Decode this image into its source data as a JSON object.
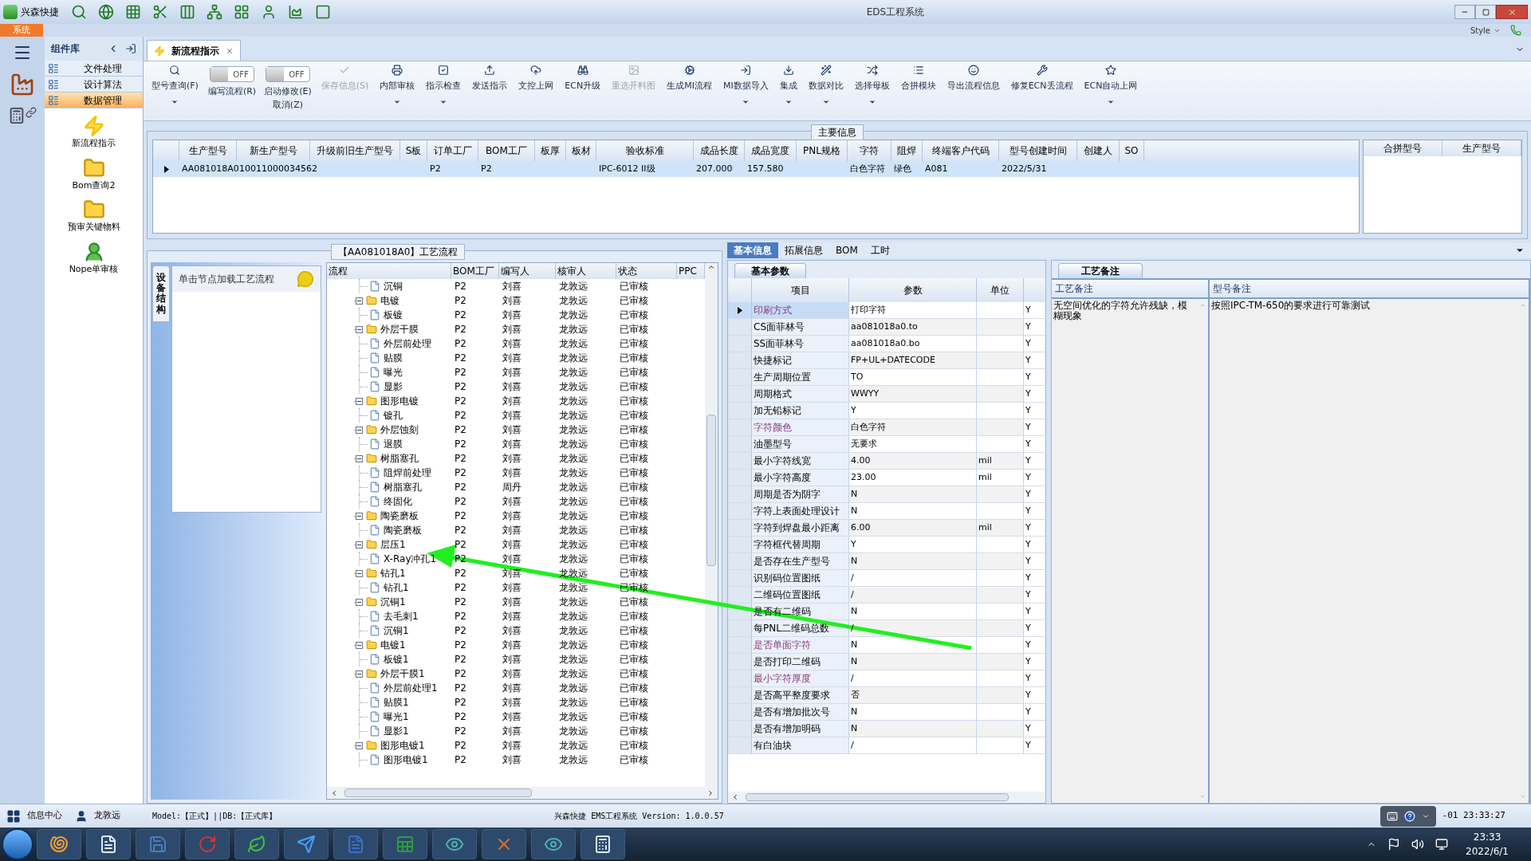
{
  "title_bar": {
    "app": "兴森快捷",
    "title": "EDS工程系统"
  },
  "ribbon": {
    "tab": "系统",
    "style": "Style"
  },
  "sidebar": {
    "title": "组件库",
    "sections": [
      {
        "label": "文件处理",
        "selected": false
      },
      {
        "label": "设计算法",
        "selected": false
      },
      {
        "label": "数据管理",
        "selected": true
      }
    ],
    "items": [
      {
        "label": "新流程指示",
        "kind": "bolt"
      },
      {
        "label": "Bom查询2",
        "kind": "folder"
      },
      {
        "label": "预审关键物料",
        "kind": "folder"
      },
      {
        "label": "Nope单审核",
        "kind": "person"
      }
    ]
  },
  "document_tabs": [
    {
      "label": "新流程指示",
      "selected": true
    }
  ],
  "toolbar": [
    {
      "kind": "button",
      "label": "型号查询(F)",
      "disabled": false,
      "has_menu": true
    },
    {
      "kind": "toggle",
      "label": "编写流程(R)",
      "switch": "OFF",
      "on": false
    },
    {
      "kind": "toggle",
      "label": "启动修改(E)",
      "switch": "OFF",
      "on": false,
      "sub_label": "取消(Z)"
    },
    {
      "kind": "button",
      "label": "保存信息(S)",
      "disabled": true,
      "has_menu": false
    },
    {
      "kind": "button",
      "label": "内部审核",
      "disabled": false,
      "has_menu": true
    },
    {
      "kind": "button",
      "label": "指示检查",
      "disabled": false,
      "has_menu": true
    },
    {
      "kind": "button",
      "label": "发送指示",
      "disabled": false,
      "has_menu": false
    },
    {
      "kind": "button",
      "label": "文控上网",
      "disabled": false,
      "has_menu": false
    },
    {
      "kind": "button",
      "label": "ECN升级",
      "disabled": false,
      "has_menu": false
    },
    {
      "kind": "button",
      "label": "重选开料图",
      "disabled": true,
      "has_menu": false
    },
    {
      "kind": "button",
      "label": "生成MI流程",
      "disabled": false,
      "has_menu": false
    },
    {
      "kind": "button",
      "label": "MI数据导入",
      "disabled": false,
      "has_menu": true
    },
    {
      "kind": "button",
      "label": "集成",
      "disabled": false,
      "has_menu": true
    },
    {
      "kind": "button",
      "label": "数据对比",
      "disabled": false,
      "has_menu": true
    },
    {
      "kind": "button",
      "label": "选择母板",
      "disabled": false,
      "has_menu": true
    },
    {
      "kind": "button",
      "label": "合拼模块",
      "disabled": false,
      "has_menu": false
    },
    {
      "kind": "button",
      "label": "导出流程信息",
      "disabled": false,
      "has_menu": false
    },
    {
      "kind": "button",
      "label": "修复ECN丢流程",
      "disabled": false,
      "has_menu": false
    },
    {
      "kind": "button",
      "label": "ECN自动上网",
      "disabled": false,
      "has_menu": true
    }
  ],
  "main_info": {
    "title": "主要信息",
    "row_selected": true,
    "columns": [
      {
        "header": "生产型号",
        "value": "AA081018A0"
      },
      {
        "header": "新生产型号",
        "value": "10011000034562"
      },
      {
        "header": "升级前旧生产型号"
      },
      {
        "header": "S板"
      },
      {
        "header": "订单工厂",
        "value": "P2"
      },
      {
        "header": "BOM工厂",
        "value": "P2"
      },
      {
        "header": "板厚"
      },
      {
        "header": "板材"
      },
      {
        "header": "验收标准",
        "value": "IPC-6012 II级"
      },
      {
        "header": "成品长度",
        "value": "207.000"
      },
      {
        "header": "成品宽度",
        "value": "157.580"
      },
      {
        "header": "PNL规格"
      },
      {
        "header": "字符",
        "value": "白色字符"
      },
      {
        "header": "阻焊",
        "value": "绿色"
      },
      {
        "header": "终端客户代码",
        "value": "A081"
      },
      {
        "header": "型号创建时间",
        "value": "2022/5/31"
      },
      {
        "header": "创建人"
      },
      {
        "header": "SO"
      }
    ]
  },
  "merge_table": {
    "columns": [
      "合拼型号",
      "生产型号"
    ]
  },
  "process_flow": {
    "title": "【AA081018A0】工艺流程",
    "side_tab": "设备结构",
    "hint": "单击节点加载工艺流程",
    "columns": [
      "流程",
      "BOM工厂",
      "编写人",
      "核审人",
      "状态",
      "PPC"
    ],
    "nodes": [
      {
        "name": "沉铜",
        "kind": "leaf",
        "bom": "P2",
        "writer": "刘喜",
        "reviewer": "龙敦远",
        "status": "已审核"
      },
      {
        "name": "电镀",
        "kind": "folder",
        "expanded": true,
        "bom": "P2",
        "writer": "刘喜",
        "reviewer": "龙敦远",
        "status": "已审核",
        "children": [
          {
            "name": "板镀",
            "kind": "leaf",
            "bom": "P2",
            "writer": "刘喜",
            "reviewer": "龙敦远",
            "status": "已审核"
          }
        ]
      },
      {
        "name": "外层干膜",
        "kind": "folder",
        "expanded": true,
        "bom": "P2",
        "writer": "刘喜",
        "reviewer": "龙敦远",
        "status": "已审核",
        "children": [
          {
            "name": "外层前处理",
            "kind": "leaf",
            "bom": "P2",
            "writer": "刘喜",
            "reviewer": "龙敦远",
            "status": "已审核"
          },
          {
            "name": "贴膜",
            "kind": "leaf",
            "bom": "P2",
            "writer": "刘喜",
            "reviewer": "龙敦远",
            "status": "已审核"
          },
          {
            "name": "曝光",
            "kind": "leaf",
            "bom": "P2",
            "writer": "刘喜",
            "reviewer": "龙敦远",
            "status": "已审核"
          },
          {
            "name": "显影",
            "kind": "leaf",
            "bom": "P2",
            "writer": "刘喜",
            "reviewer": "龙敦远",
            "status": "已审核"
          }
        ]
      },
      {
        "name": "图形电镀",
        "kind": "folder",
        "expanded": true,
        "bom": "P2",
        "writer": "刘喜",
        "reviewer": "龙敦远",
        "status": "已审核",
        "children": [
          {
            "name": "镀孔",
            "kind": "leaf",
            "bom": "P2",
            "writer": "刘喜",
            "reviewer": "龙敦远",
            "status": "已审核"
          }
        ]
      },
      {
        "name": "外层蚀刻",
        "kind": "folder",
        "expanded": true,
        "bom": "P2",
        "writer": "刘喜",
        "reviewer": "龙敦远",
        "status": "已审核",
        "children": [
          {
            "name": "退膜",
            "kind": "leaf",
            "bom": "P2",
            "writer": "刘喜",
            "reviewer": "龙敦远",
            "status": "已审核"
          }
        ]
      },
      {
        "name": "树脂塞孔",
        "kind": "folder",
        "expanded": true,
        "bom": "P2",
        "writer": "刘喜",
        "reviewer": "龙敦远",
        "status": "已审核",
        "children": [
          {
            "name": "阻焊前处理",
            "kind": "leaf",
            "bom": "P2",
            "writer": "刘喜",
            "reviewer": "龙敦远",
            "status": "已审核"
          },
          {
            "name": "树脂塞孔",
            "kind": "leaf",
            "bom": "P2",
            "writer": "周丹",
            "reviewer": "龙敦远",
            "status": "已审核"
          },
          {
            "name": "终固化",
            "kind": "leaf",
            "bom": "P2",
            "writer": "刘喜",
            "reviewer": "龙敦远",
            "status": "已审核"
          }
        ]
      },
      {
        "name": "陶瓷磨板",
        "kind": "folder",
        "expanded": true,
        "bom": "P2",
        "writer": "刘喜",
        "reviewer": "龙敦远",
        "status": "已审核",
        "children": [
          {
            "name": "陶瓷磨板",
            "kind": "leaf",
            "bom": "P2",
            "writer": "刘喜",
            "reviewer": "龙敦远",
            "status": "已审核"
          }
        ]
      },
      {
        "name": "层压1",
        "kind": "folder",
        "expanded": true,
        "bom": "P2",
        "writer": "刘喜",
        "reviewer": "龙敦远",
        "status": "已审核",
        "children": [
          {
            "name": "X-Ray冲孔1",
            "kind": "leaf",
            "bom": "P2",
            "writer": "刘喜",
            "reviewer": "龙敦远",
            "status": "已审核"
          }
        ]
      },
      {
        "name": "钻孔1",
        "kind": "folder",
        "expanded": true,
        "bom": "P2",
        "writer": "刘喜",
        "reviewer": "龙敦远",
        "status": "已审核",
        "children": [
          {
            "name": "钻孔1",
            "kind": "leaf",
            "bom": "P2",
            "writer": "刘喜",
            "reviewer": "龙敦远",
            "status": "已审核"
          }
        ]
      },
      {
        "name": "沉铜1",
        "kind": "folder",
        "expanded": true,
        "bom": "P2",
        "writer": "刘喜",
        "reviewer": "龙敦远",
        "status": "已审核",
        "children": [
          {
            "name": "去毛刺1",
            "kind": "leaf",
            "bom": "P2",
            "writer": "刘喜",
            "reviewer": "龙敦远",
            "status": "已审核"
          },
          {
            "name": "沉铜1",
            "kind": "leaf",
            "bom": "P2",
            "writer": "刘喜",
            "reviewer": "龙敦远",
            "status": "已审核"
          }
        ]
      },
      {
        "name": "电镀1",
        "kind": "folder",
        "expanded": true,
        "bom": "P2",
        "writer": "刘喜",
        "reviewer": "龙敦远",
        "status": "已审核",
        "children": [
          {
            "name": "板镀1",
            "kind": "leaf",
            "bom": "P2",
            "writer": "刘喜",
            "reviewer": "龙敦远",
            "status": "已审核"
          }
        ]
      },
      {
        "name": "外层干膜1",
        "kind": "folder",
        "expanded": true,
        "bom": "P2",
        "writer": "刘喜",
        "reviewer": "龙敦远",
        "status": "已审核",
        "children": [
          {
            "name": "外层前处理1",
            "kind": "leaf",
            "bom": "P2",
            "writer": "刘喜",
            "reviewer": "龙敦远",
            "status": "已审核"
          },
          {
            "name": "贴膜1",
            "kind": "leaf",
            "bom": "P2",
            "writer": "刘喜",
            "reviewer": "龙敦远",
            "status": "已审核"
          },
          {
            "name": "曝光1",
            "kind": "leaf",
            "bom": "P2",
            "writer": "刘喜",
            "reviewer": "龙敦远",
            "status": "已审核"
          },
          {
            "name": "显影1",
            "kind": "leaf",
            "bom": "P2",
            "writer": "刘喜",
            "reviewer": "龙敦远",
            "status": "已审核"
          }
        ]
      },
      {
        "name": "图形电镀1",
        "kind": "folder",
        "expanded": true,
        "bom": "P2",
        "writer": "刘喜",
        "reviewer": "龙敦远",
        "status": "已审核",
        "children": [
          {
            "name": "图形电镀1",
            "kind": "leaf",
            "bom": "P2",
            "writer": "刘喜",
            "reviewer": "龙敦远",
            "status": "已审核"
          }
        ]
      }
    ]
  },
  "detail_tabs": [
    {
      "label": "基本信息",
      "selected": true
    },
    {
      "label": "拓展信息",
      "selected": false
    },
    {
      "label": "BOM",
      "selected": false
    },
    {
      "label": "工时",
      "selected": false
    }
  ],
  "basic_params": {
    "tab": "基本参数",
    "columns": [
      "项目",
      "参数",
      "单位"
    ],
    "rows": [
      {
        "item": "印刷方式",
        "value": "打印字符",
        "column_4": "Y",
        "highlighted": true,
        "selected": true
      },
      {
        "item": "CS面菲林号",
        "value": "aa081018a0.to",
        "column_4": "Y",
        "highlighted": false,
        "selected": false
      },
      {
        "item": "SS面菲林号",
        "value": "aa081018a0.bo",
        "column_4": "Y",
        "highlighted": false,
        "selected": false
      },
      {
        "item": "快捷标记",
        "value": "FP+UL+DATECODE",
        "column_4": "Y",
        "highlighted": false,
        "selected": false
      },
      {
        "item": "生产周期位置",
        "value": "TO",
        "column_4": "Y",
        "highlighted": false,
        "selected": false
      },
      {
        "item": "周期格式",
        "value": "WWYY",
        "column_4": "Y",
        "highlighted": false,
        "selected": false
      },
      {
        "item": "加无铅标记",
        "value": "Y",
        "column_4": "Y",
        "highlighted": false,
        "selected": false
      },
      {
        "item": "字符颜色",
        "value": "白色字符",
        "column_4": "Y",
        "highlighted": true,
        "selected": false
      },
      {
        "item": "油墨型号",
        "value": "无要求",
        "column_4": "Y",
        "highlighted": false,
        "selected": false
      },
      {
        "item": "最小字符线宽",
        "value": "4.00",
        "unit": "mil",
        "column_4": "Y",
        "highlighted": false,
        "selected": false
      },
      {
        "item": "最小字符高度",
        "value": "23.00",
        "unit": "mil",
        "column_4": "Y",
        "highlighted": false,
        "selected": false
      },
      {
        "item": "周期是否为阴字",
        "value": "N",
        "column_4": "Y",
        "highlighted": false,
        "selected": false
      },
      {
        "item": "字符上表面处理设计",
        "value": "N",
        "column_4": "Y",
        "highlighted": false,
        "selected": false
      },
      {
        "item": "字符到焊盘最小距离",
        "value": "6.00",
        "unit": "mil",
        "column_4": "Y",
        "highlighted": false,
        "selected": false
      },
      {
        "item": "字符框代替周期",
        "value": "Y",
        "column_4": "Y",
        "highlighted": false,
        "selected": false
      },
      {
        "item": "是否存在生产型号",
        "value": "N",
        "column_4": "Y",
        "highlighted": false,
        "selected": false
      },
      {
        "item": "识别码位置图纸",
        "value": "/",
        "column_4": "Y",
        "highlighted": false,
        "selected": false
      },
      {
        "item": "二维码位置图纸",
        "value": "/",
        "column_4": "Y",
        "highlighted": false,
        "selected": false
      },
      {
        "item": "是否有二维码",
        "value": "N",
        "column_4": "Y",
        "highlighted": false,
        "selected": false
      },
      {
        "item": "每PNL二维码总数",
        "value": "/",
        "column_4": "Y",
        "highlighted": false,
        "selected": false
      },
      {
        "item": "是否单面字符",
        "value": "N",
        "column_4": "Y",
        "highlighted": true,
        "selected": false
      },
      {
        "item": "是否打印二维码",
        "value": "N",
        "column_4": "Y",
        "highlighted": false,
        "selected": false
      },
      {
        "item": "最小字符厚度",
        "value": "/",
        "column_4": "Y",
        "highlighted": true,
        "selected": false
      },
      {
        "item": "是否高平整度要求",
        "value": "否",
        "column_4": "Y",
        "highlighted": false,
        "selected": false
      },
      {
        "item": "是否有增加批次号",
        "value": "N",
        "column_4": "Y",
        "highlighted": false,
        "selected": false
      },
      {
        "item": "是否有增加明码",
        "value": "N",
        "column_4": "Y",
        "highlighted": false,
        "selected": false
      },
      {
        "item": "有白油块",
        "value": "/",
        "column_4": "Y",
        "highlighted": false,
        "selected": false
      }
    ]
  },
  "notes": {
    "tab": "工艺备注",
    "columns": [
      {
        "header": "工艺备注",
        "text": "无空间优化的字符允许残缺，模糊现象"
      },
      {
        "header": "型号备注",
        "text": "按照IPC-TM-650的要求进行可靠测试"
      }
    ]
  },
  "status_bar": {
    "label": "信息中心",
    "user": "龙敦远",
    "mode": "Model:【正式】||DB:【正式库】",
    "version": "兴森快捷 EMS工程系统 Version: 1.0.0.57",
    "time": "-01 23:33:27"
  },
  "taskbar": {
    "time": "23:33",
    "date": "2022/6/1"
  }
}
